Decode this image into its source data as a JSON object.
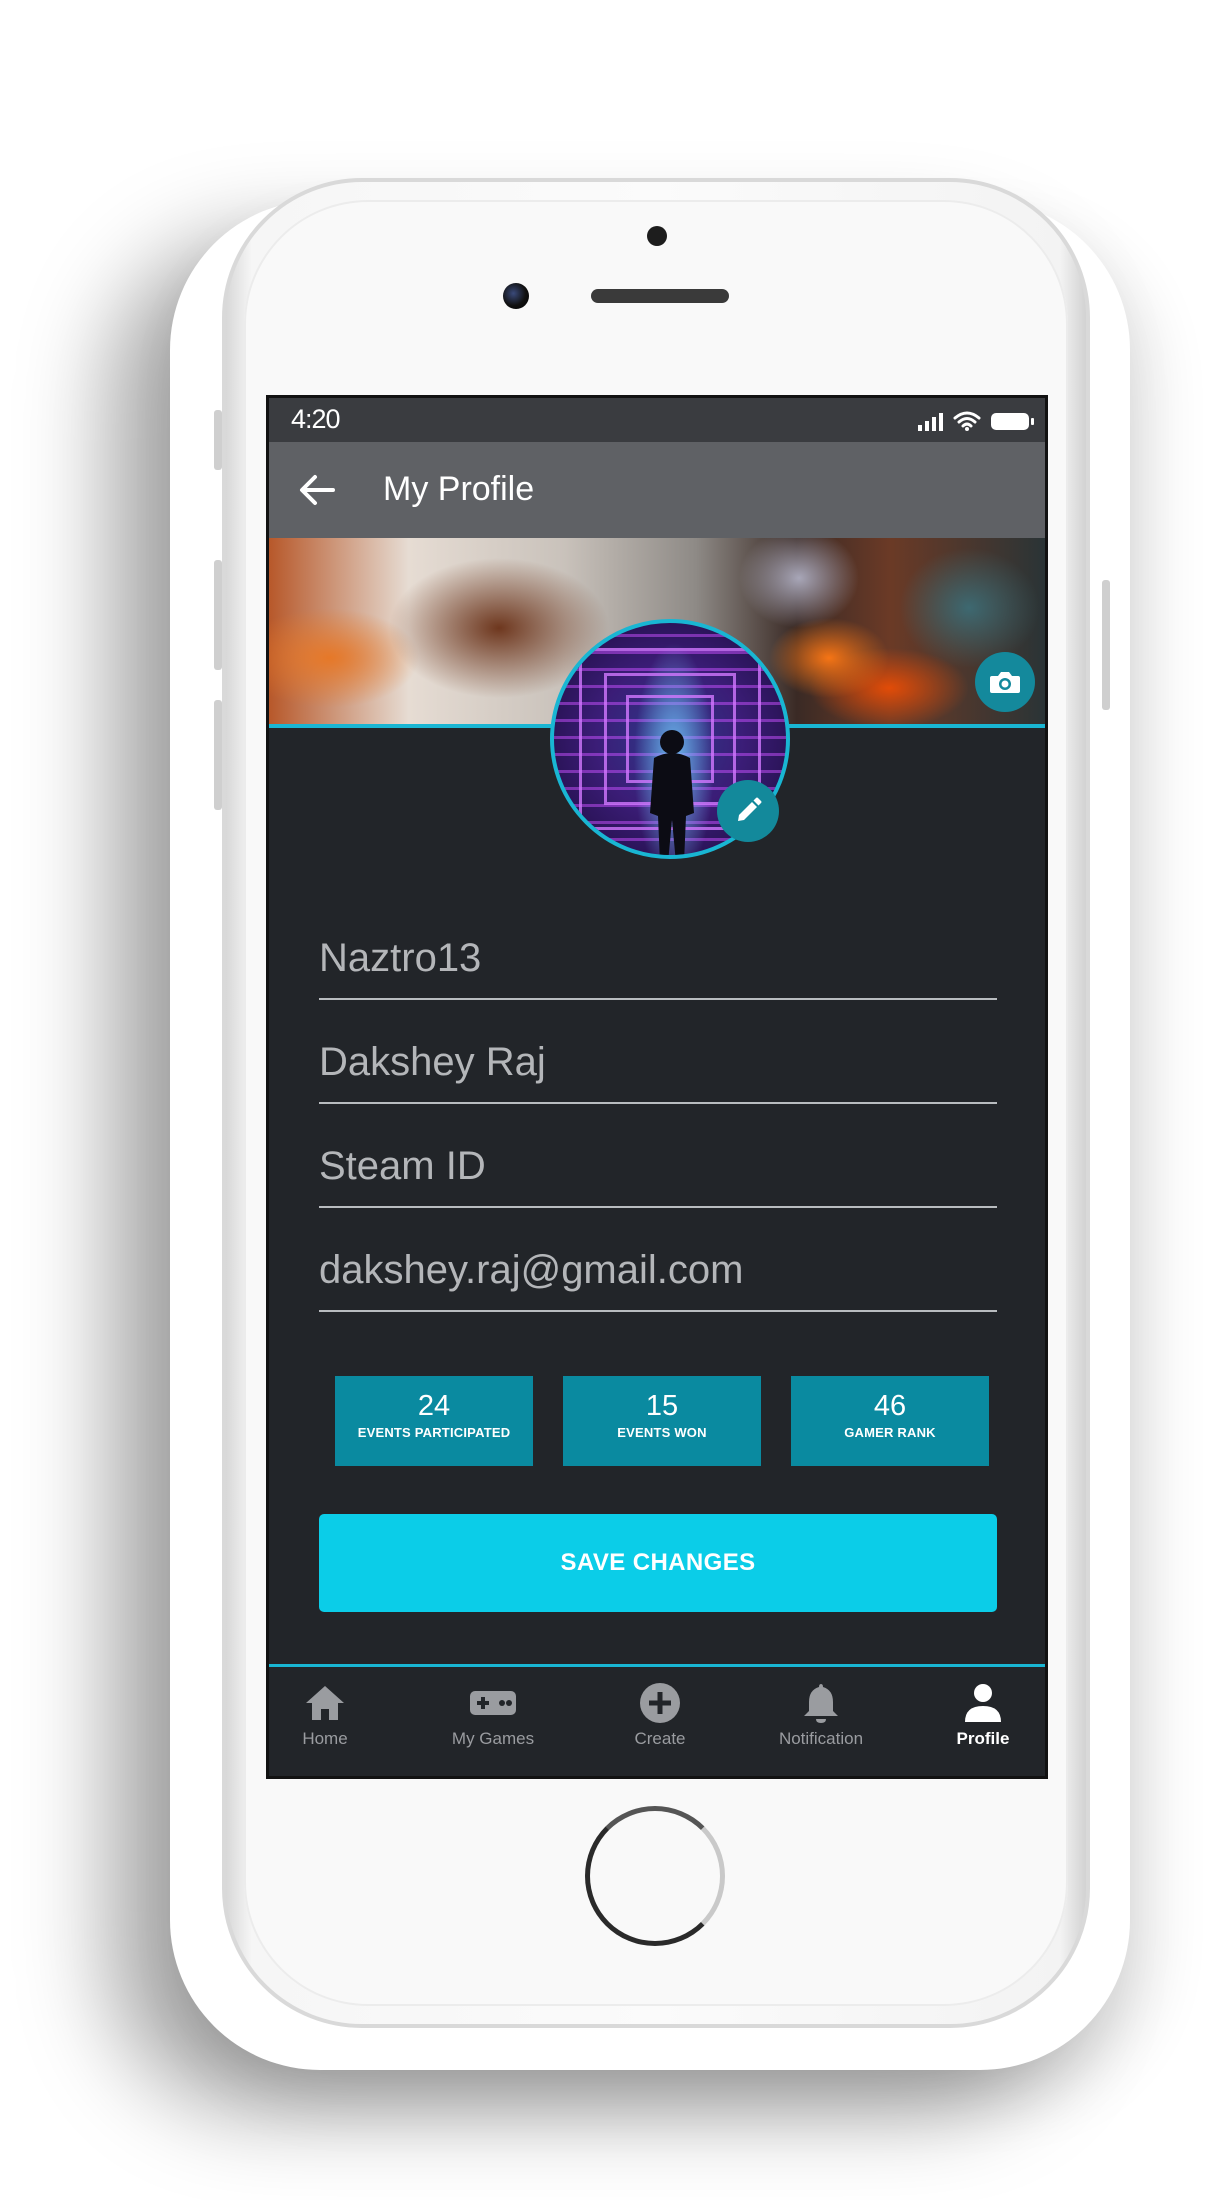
{
  "status_bar": {
    "time": "4:20"
  },
  "app_bar": {
    "title": "My Profile"
  },
  "profile": {
    "fields": [
      {
        "id": "username",
        "value": "Naztro13"
      },
      {
        "id": "full_name",
        "value": "Dakshey Raj"
      },
      {
        "id": "steam_id",
        "value": "Steam ID"
      },
      {
        "id": "email",
        "value": "dakshey.raj@gmail.com"
      }
    ],
    "stats": [
      {
        "value": "24",
        "label": "EVENTS PARTICIPATED"
      },
      {
        "value": "15",
        "label": "EVENTS WON"
      },
      {
        "value": "46",
        "label": "GAMER RANK"
      }
    ],
    "save_label": "SAVE CHANGES"
  },
  "nav": {
    "items": [
      {
        "label": "Home",
        "icon": "home-icon"
      },
      {
        "label": "My Games",
        "icon": "gamepad-icon"
      },
      {
        "label": "Create",
        "icon": "plus-circle-icon"
      },
      {
        "label": "Notification",
        "icon": "bell-icon"
      },
      {
        "label": "Profile",
        "icon": "person-icon"
      }
    ],
    "active": "Profile"
  },
  "colors": {
    "accent": "#19b6d3",
    "save_button": "#0bcde8",
    "stat_tile": "#0a8aa0",
    "app_bar": "#5f6165",
    "background": "#222529"
  }
}
